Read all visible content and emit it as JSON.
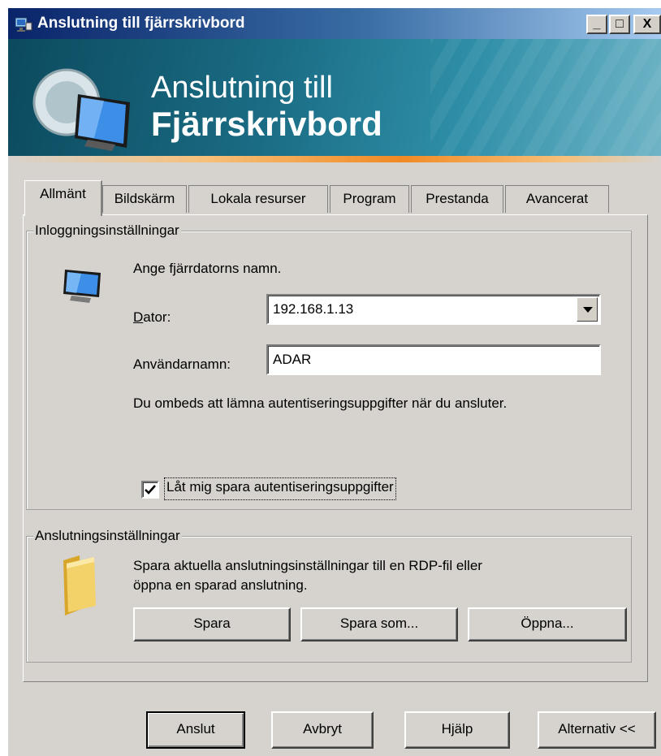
{
  "window": {
    "title": "Anslutning till fjärrskrivbord",
    "controls": {
      "minimize": "_",
      "maximize": "□",
      "close": "X"
    }
  },
  "banner": {
    "line1": "Anslutning till",
    "line2": "Fjärrskrivbord"
  },
  "tabs": [
    {
      "label": "Allmänt",
      "active": true
    },
    {
      "label": "Bildskärm",
      "active": false
    },
    {
      "label": "Lokala resurser",
      "active": false
    },
    {
      "label": "Program",
      "active": false
    },
    {
      "label": "Prestanda",
      "active": false
    },
    {
      "label": "Avancerat",
      "active": false
    }
  ],
  "login": {
    "group_label": "Inloggningsinställningar",
    "prompt": "Ange fjärrdatorns namn.",
    "computer_label": "Dator:",
    "computer_value": "192.168.1.13",
    "username_label": "Användarnamn:",
    "username_value": "ADAR",
    "note": "Du ombeds att lämna autentiseringsuppgifter när du ansluter.",
    "save_credentials_label": "Låt mig spara autentiseringsuppgifter",
    "save_credentials_checked": true
  },
  "connection": {
    "group_label": "Anslutningsinställningar",
    "description_line1": "Spara aktuella anslutningsinställningar till en RDP-fil eller",
    "description_line2": "öppna en sparad anslutning.",
    "save_label": "Spara",
    "save_as_label": "Spara som...",
    "open_label": "Öppna..."
  },
  "footer": {
    "connect_label": "Anslut",
    "cancel_label": "Avbryt",
    "help_label": "Hjälp",
    "options_label": "Alternativ <<"
  },
  "colors": {
    "dialog_bg": "#d6d3ce",
    "titlebar_start": "#0a246a",
    "titlebar_end": "#a6caf0",
    "banner": "#1a6c84",
    "banner_accent": "#f08a24"
  },
  "icons": [
    "remote-desktop-icon",
    "computer-monitor-icon",
    "folder-icon",
    "chevron-down-icon",
    "checkmark-icon"
  ]
}
